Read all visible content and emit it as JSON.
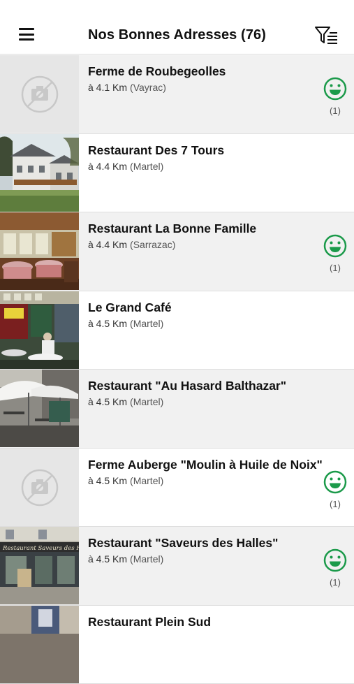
{
  "header": {
    "title": "Nos Bonnes Adresses (76)",
    "menu_icon": "hamburger-menu-icon",
    "filter_icon": "filter-list-icon"
  },
  "colors": {
    "accent_green": "#1b9a4a",
    "row_grey": "#f1f1f1"
  },
  "items": [
    {
      "name": "Ferme de Roubegeolles",
      "distance": "à 4.1 Km",
      "town": "(Vayrac)",
      "photo": "no-photo",
      "rating_icon": "smiley-icon",
      "rating_count": "(1)"
    },
    {
      "name": "Restaurant Des 7 Tours",
      "distance": "à 4.4 Km",
      "town": "(Martel)",
      "photo": "photo"
    },
    {
      "name": "Restaurant La Bonne Famille",
      "distance": "à 4.4 Km",
      "town": "(Sarrazac)",
      "photo": "photo",
      "rating_icon": "smiley-icon",
      "rating_count": "(1)"
    },
    {
      "name": "Le Grand Café",
      "distance": "à 4.5 Km",
      "town": "(Martel)",
      "photo": "photo"
    },
    {
      "name": "Restaurant \"Au Hasard Balthazar\"",
      "distance": "à 4.5 Km",
      "town": "(Martel)",
      "photo": "photo"
    },
    {
      "name": "Ferme Auberge \"Moulin à Huile de Noix\"",
      "distance": "à 4.5 Km",
      "town": "(Martel)",
      "photo": "no-photo",
      "rating_icon": "smiley-icon",
      "rating_count": "(1)"
    },
    {
      "name": "Restaurant \"Saveurs des Halles\"",
      "distance": "à 4.5 Km",
      "town": "(Martel)",
      "photo": "photo",
      "sign_text": "Restaurant Saveurs des H",
      "rating_icon": "smiley-icon",
      "rating_count": "(1)"
    },
    {
      "name": "Restaurant Plein Sud",
      "distance": "",
      "town": "",
      "photo": "photo"
    }
  ]
}
